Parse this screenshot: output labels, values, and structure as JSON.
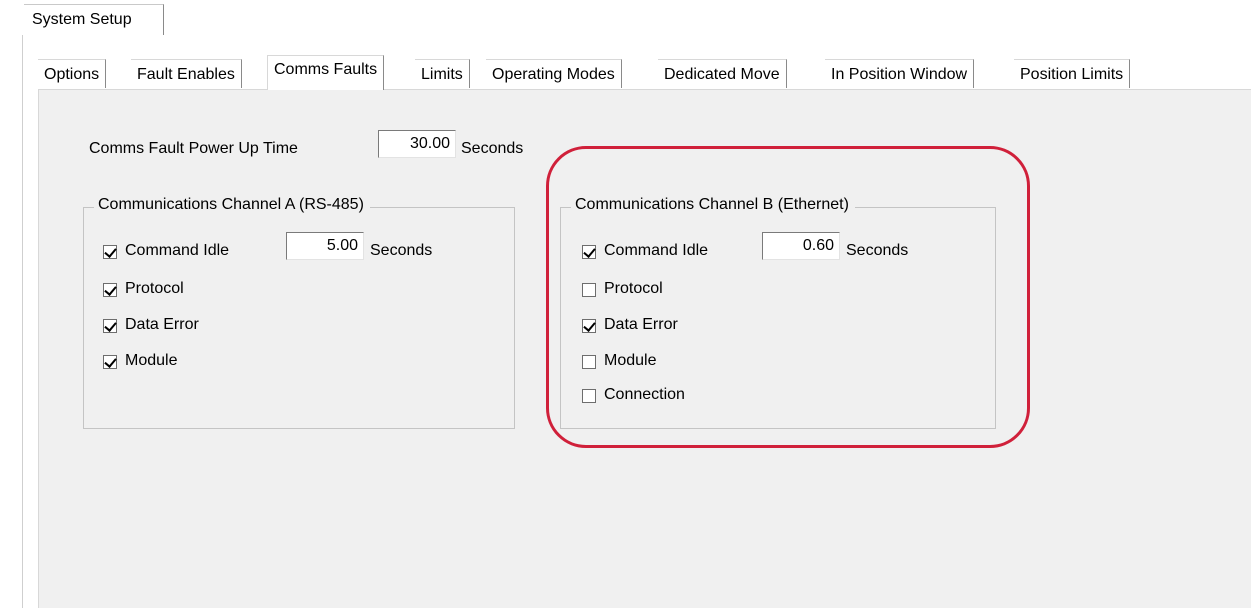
{
  "window": {
    "outer_tab": "System Setup"
  },
  "tabs": [
    {
      "label": "Options"
    },
    {
      "label": "Fault Enables"
    },
    {
      "label": "Comms Faults"
    },
    {
      "label": "Limits"
    },
    {
      "label": "Operating Modes"
    },
    {
      "label": "Dedicated Move"
    },
    {
      "label": "In Position Window"
    },
    {
      "label": "Position Limits"
    }
  ],
  "active_tab": "Comms Faults",
  "power_up": {
    "label": "Comms Fault Power Up Time",
    "value": "30.00",
    "unit": "Seconds"
  },
  "channel_a": {
    "title": "Communications Channel A (RS-485)",
    "command_idle": {
      "label": "Command Idle",
      "checked": true,
      "value": "5.00",
      "unit": "Seconds"
    },
    "items": [
      {
        "label": "Protocol",
        "checked": true
      },
      {
        "label": "Data Error",
        "checked": true
      },
      {
        "label": "Module",
        "checked": true
      }
    ]
  },
  "channel_b": {
    "title": "Communications Channel B (Ethernet)",
    "command_idle": {
      "label": "Command Idle",
      "checked": true,
      "value": "0.60",
      "unit": "Seconds"
    },
    "items": [
      {
        "label": "Protocol",
        "checked": false
      },
      {
        "label": "Data Error",
        "checked": true
      },
      {
        "label": "Module",
        "checked": false
      },
      {
        "label": "Connection",
        "checked": false
      }
    ]
  },
  "annotation": {
    "color": "#d0203a"
  }
}
